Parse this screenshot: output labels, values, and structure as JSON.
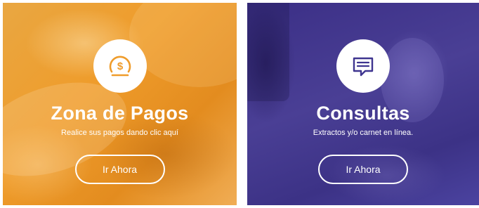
{
  "cards": [
    {
      "title": "Zona de Pagos",
      "subtitle": "Realice sus pagos dando clic aquí",
      "button_label": "Ir Ahora",
      "icon": "dollar-coin-icon",
      "accent": "#ef9c2b"
    },
    {
      "title": "Consultas",
      "subtitle": "Extractos y/o carnet en línea.",
      "button_label": "Ir Ahora",
      "icon": "chat-bubble-icon",
      "accent": "#3f3590"
    }
  ]
}
